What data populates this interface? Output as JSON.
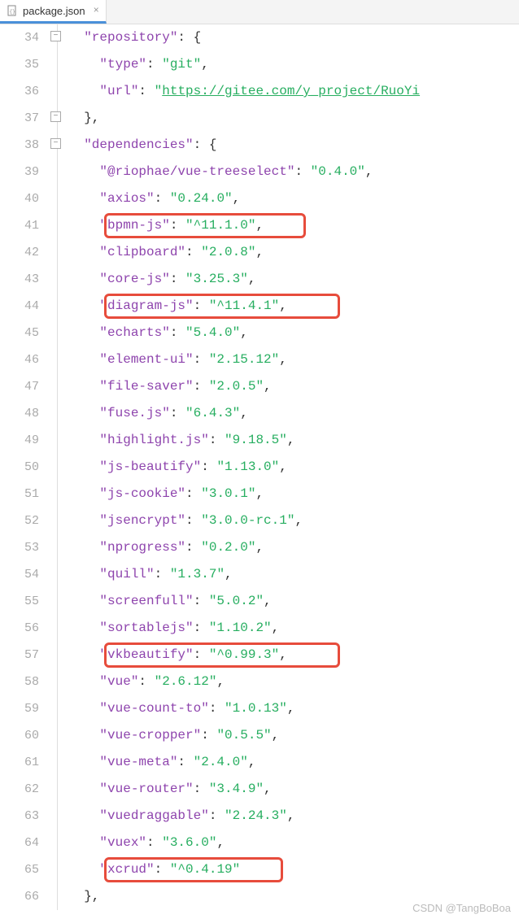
{
  "tab": {
    "filename": "package.json"
  },
  "gutter_start": 34,
  "code": {
    "repository": {
      "key": "repository",
      "type_key": "type",
      "type_val": "git",
      "url_key": "url",
      "url_val": "https://gitee.com/y_project/RuoYi"
    },
    "dependencies_key": "dependencies",
    "deps": [
      {
        "k": "@riophae/vue-treeselect",
        "v": "0.4.0"
      },
      {
        "k": "axios",
        "v": "0.24.0"
      },
      {
        "k": "bpmn-js",
        "v": "^11.1.0"
      },
      {
        "k": "clipboard",
        "v": "2.0.8"
      },
      {
        "k": "core-js",
        "v": "3.25.3"
      },
      {
        "k": "diagram-js",
        "v": "^11.4.1"
      },
      {
        "k": "echarts",
        "v": "5.4.0"
      },
      {
        "k": "element-ui",
        "v": "2.15.12"
      },
      {
        "k": "file-saver",
        "v": "2.0.5"
      },
      {
        "k": "fuse.js",
        "v": "6.4.3"
      },
      {
        "k": "highlight.js",
        "v": "9.18.5"
      },
      {
        "k": "js-beautify",
        "v": "1.13.0"
      },
      {
        "k": "js-cookie",
        "v": "3.0.1"
      },
      {
        "k": "jsencrypt",
        "v": "3.0.0-rc.1"
      },
      {
        "k": "nprogress",
        "v": "0.2.0"
      },
      {
        "k": "quill",
        "v": "1.3.7"
      },
      {
        "k": "screenfull",
        "v": "5.0.2"
      },
      {
        "k": "sortablejs",
        "v": "1.10.2"
      },
      {
        "k": "vkbeautify",
        "v": "^0.99.3"
      },
      {
        "k": "vue",
        "v": "2.6.12"
      },
      {
        "k": "vue-count-to",
        "v": "1.0.13"
      },
      {
        "k": "vue-cropper",
        "v": "0.5.5"
      },
      {
        "k": "vue-meta",
        "v": "2.4.0"
      },
      {
        "k": "vue-router",
        "v": "3.4.9"
      },
      {
        "k": "vuedraggable",
        "v": "2.24.3"
      },
      {
        "k": "vuex",
        "v": "3.6.0"
      },
      {
        "k": "xcrud",
        "v": "^0.4.19"
      }
    ]
  },
  "watermark": "CSDN @TangBoBoa",
  "highlight_lines": [
    41,
    44,
    57,
    65
  ],
  "highlight_widths": {
    "41": 248,
    "44": 290,
    "57": 290,
    "65": 220
  }
}
